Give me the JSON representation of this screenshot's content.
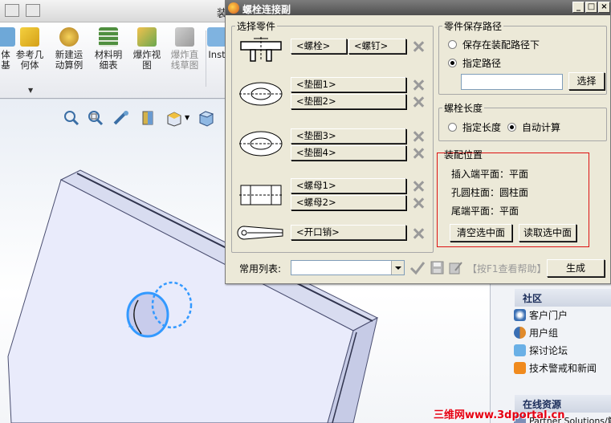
{
  "app": {
    "title_fragment": "装",
    "ribbon": [
      {
        "label": "体\n基",
        "icon": "solid-body-icon"
      },
      {
        "label": "参考几\n何体",
        "icon": "reference-geometry-icon"
      },
      {
        "label": "新建运\n动算例",
        "icon": "motion-study-icon"
      },
      {
        "label": "材料明\n细表",
        "icon": "bom-table-icon"
      },
      {
        "label": "爆炸视\n图",
        "icon": "exploded-view-icon"
      },
      {
        "label": "爆炸直\n线草图",
        "icon": "explode-line-sketch-icon"
      },
      {
        "label": "Inst",
        "icon": "instant3d-icon"
      }
    ],
    "right_panel": {
      "community_header": "社区",
      "community_items": [
        "客户门户",
        "用户组",
        "探讨论坛",
        "技术警戒和新闻"
      ],
      "online_header": "在线资源",
      "online_items": [
        "Partner Solutions/解"
      ]
    },
    "watermark": "三维网www.3dportal.cn"
  },
  "dialog": {
    "title": "螺栓连接副",
    "window_buttons": [
      "_",
      "□",
      "×"
    ],
    "select_parts": {
      "legend": "选择零件",
      "bolt_label": "<螺栓>",
      "screw_label": "<螺钉>",
      "washer1_label": "<垫圈1>",
      "washer2_label": "<垫圈2>",
      "washer3_label": "<垫圈3>",
      "washer4_label": "<垫圈4>",
      "nut1_label": "<螺母1>",
      "nut2_label": "<螺母2>",
      "pin_label": "<开口销>"
    },
    "save_path": {
      "legend": "零件保存路径",
      "option_assembly": "保存在装配路径下",
      "option_specified": "指定路径",
      "selected": "specified",
      "path_value": "",
      "browse_label": "选择"
    },
    "bolt_length": {
      "legend": "螺栓长度",
      "option_specified": "指定长度",
      "option_auto": "自动计算",
      "selected": "auto"
    },
    "assembly_position": {
      "legend": "装配位置",
      "insert_face": "插入端平面：平面",
      "hole_face": "孔圆柱面：圆柱面",
      "tail_face": "尾端平面：平面",
      "clear_label": "清空选中面",
      "read_label": "读取选中面"
    },
    "bottom": {
      "common_list_label": "常用列表:",
      "common_list_value": "",
      "help_text": "【按F1查看帮助】",
      "generate_label": "生成"
    }
  }
}
